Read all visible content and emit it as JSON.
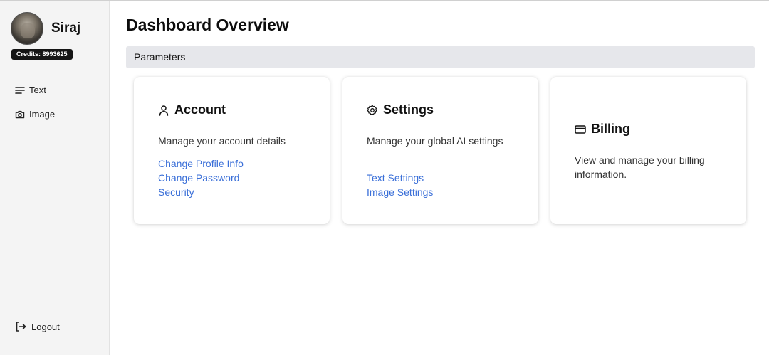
{
  "sidebar": {
    "username": "Siraj",
    "credits": "Credits: 8993625",
    "nav": [
      {
        "label": "Text",
        "icon": "menu-lines-icon"
      },
      {
        "label": "Image",
        "icon": "camera-icon"
      }
    ],
    "logout_label": "Logout"
  },
  "main": {
    "title": "Dashboard Overview",
    "section_label": "Parameters",
    "cards": [
      {
        "title": "Account",
        "icon": "user-icon",
        "description": "Manage your account details",
        "links": [
          "Change Profile Info",
          "Change Password",
          "Security"
        ]
      },
      {
        "title": "Settings",
        "icon": "gear-icon",
        "description": "Manage your global AI settings",
        "links": [
          "Text Settings",
          "Image Settings"
        ]
      },
      {
        "title": "Billing",
        "icon": "credit-card-icon",
        "description": "View and manage your billing information.",
        "links": []
      }
    ]
  },
  "colors": {
    "sidebar_bg": "#f4f4f4",
    "link": "#3a6fd8",
    "param_bar_bg": "#e6e7eb",
    "badge_bg": "#151515"
  }
}
